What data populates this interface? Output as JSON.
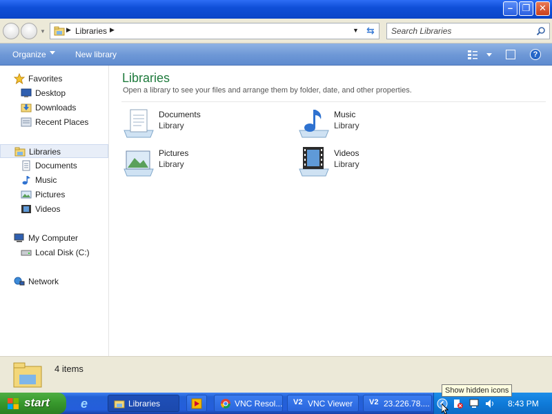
{
  "address_bar": {
    "path": "Libraries",
    "search_placeholder": "Search Libraries"
  },
  "toolbar": {
    "organize": "Organize",
    "new_library": "New library"
  },
  "sidebar": {
    "favorites": "Favorites",
    "favorites_items": [
      "Desktop",
      "Downloads",
      "Recent Places"
    ],
    "libraries": "Libraries",
    "libraries_items": [
      "Documents",
      "Music",
      "Pictures",
      "Videos"
    ],
    "computer": "My Computer",
    "computer_items": [
      "Local Disk (C:)"
    ],
    "network": "Network"
  },
  "content": {
    "title": "Libraries",
    "subtitle": "Open a library to see your files and arrange them by folder, date, and other properties.",
    "libraries": [
      {
        "name": "Documents",
        "kind": "Library"
      },
      {
        "name": "Music",
        "kind": "Library"
      },
      {
        "name": "Pictures",
        "kind": "Library"
      },
      {
        "name": "Videos",
        "kind": "Library"
      }
    ]
  },
  "details": {
    "count": "4 items"
  },
  "taskbar": {
    "start": "start",
    "tasks": [
      "Libraries",
      "VNC Resol...",
      "VNC Viewer",
      "23.226.78...."
    ],
    "time": "8:43 PM",
    "tooltip": "Show hidden icons"
  }
}
